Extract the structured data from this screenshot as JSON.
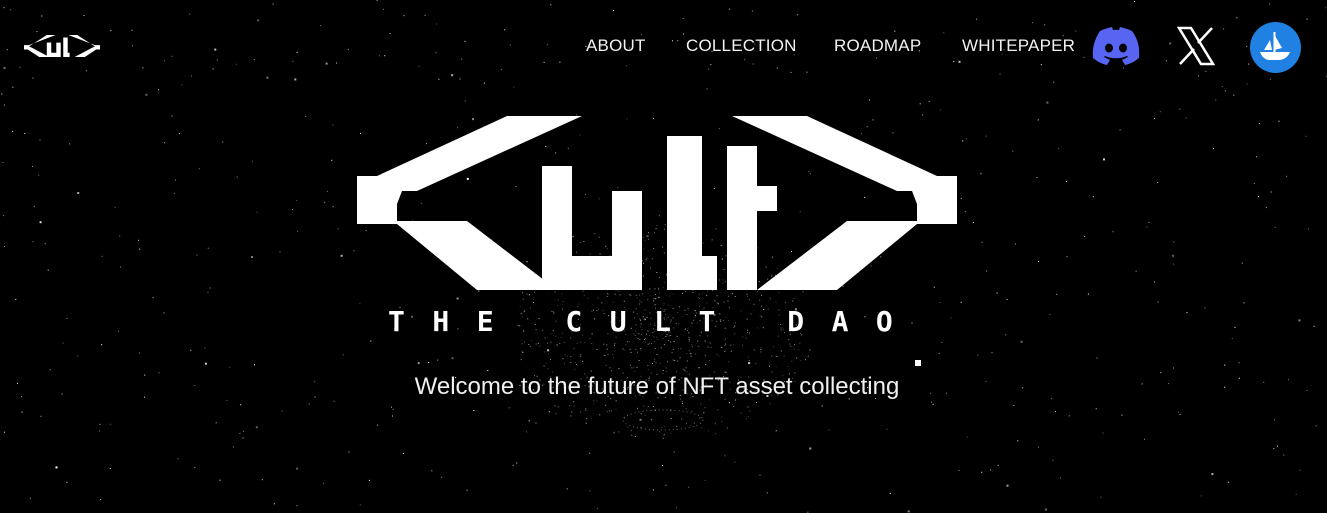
{
  "nav": {
    "items": [
      "ABOUT",
      "COLLECTION",
      "ROADMAP",
      "WHITEPAPER"
    ]
  },
  "social": {
    "discord": "discord-icon",
    "x": "x-icon",
    "opensea": "opensea-icon"
  },
  "hero": {
    "brand": "THE CULT DAO",
    "tagline": "Welcome to the future of NFT asset collecting"
  },
  "colors": {
    "background": "#000000",
    "discord": "#5865f2",
    "opensea": "#2081e2",
    "text": "#ffffff"
  }
}
